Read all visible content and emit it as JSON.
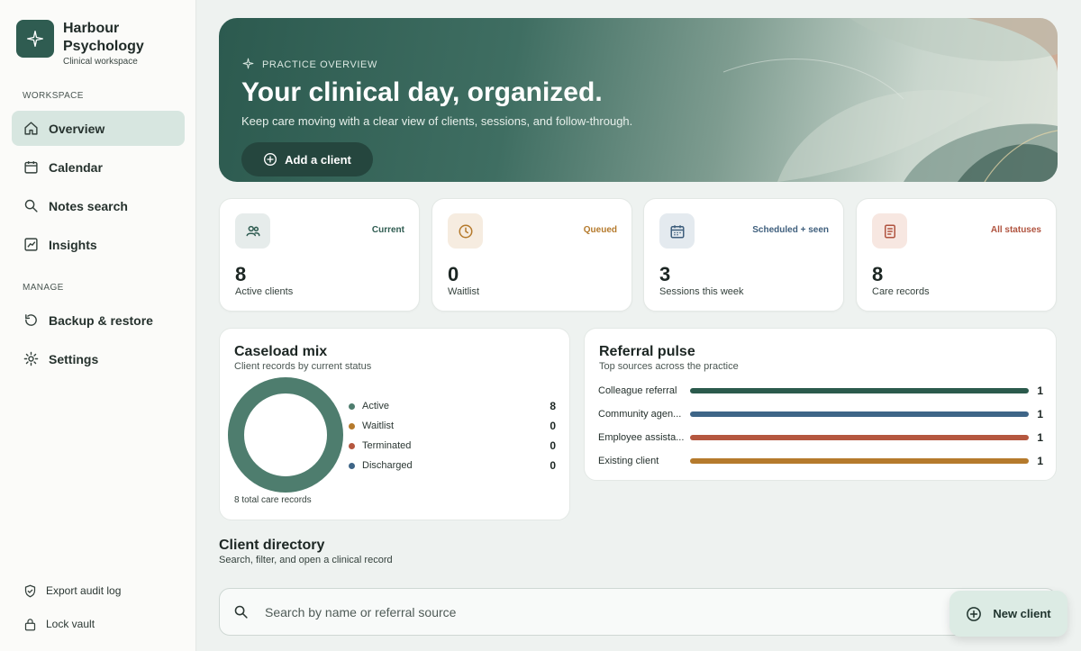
{
  "brand": {
    "name": "Harbour Psychology",
    "subtitle": "Clinical workspace"
  },
  "sidebar": {
    "workspace_label": "WORKSPACE",
    "manage_label": "MANAGE",
    "workspace_items": [
      {
        "label": "Overview",
        "icon": "home-icon",
        "active": true
      },
      {
        "label": "Calendar",
        "icon": "calendar-icon"
      },
      {
        "label": "Notes search",
        "icon": "search-icon"
      },
      {
        "label": "Insights",
        "icon": "chart-icon"
      }
    ],
    "manage_items": [
      {
        "label": "Backup & restore",
        "icon": "restore-icon"
      },
      {
        "label": "Settings",
        "icon": "gear-icon"
      }
    ],
    "footer_items": [
      {
        "label": "Export audit log",
        "icon": "shield-icon"
      },
      {
        "label": "Lock vault",
        "icon": "lock-icon"
      }
    ]
  },
  "hero": {
    "kicker": "PRACTICE OVERVIEW",
    "title": "Your clinical day, organized.",
    "description": "Keep care moving with a clear view of clients, sessions, and follow-through.",
    "button_label": "Add a client"
  },
  "stats": [
    {
      "tag": "Current",
      "value": "8",
      "label": "Active clients",
      "icon": "users-icon",
      "tag_color": "#2f5c51",
      "icon_bg": "#e6eceb"
    },
    {
      "tag": "Queued",
      "value": "0",
      "label": "Waitlist",
      "icon": "clock-icon",
      "tag_color": "#b57a2c",
      "icon_bg": "#f6ece0"
    },
    {
      "tag": "Scheduled + seen",
      "value": "3",
      "label": "Sessions this week",
      "icon": "calendar-icon",
      "tag_color": "#3f5f7d",
      "icon_bg": "#e4eaef"
    },
    {
      "tag": "All statuses",
      "value": "8",
      "label": "Care records",
      "icon": "document-icon",
      "tag_color": "#b0533f",
      "icon_bg": "#f7e7e1"
    }
  ],
  "caseload": {
    "title": "Caseload mix",
    "subtitle": "Client records by current status",
    "footer": "8 total care records",
    "items": [
      {
        "name": "Active",
        "value": 8,
        "color": "#4e7d6e"
      },
      {
        "name": "Waitlist",
        "value": 0,
        "color": "#b57a2c"
      },
      {
        "name": "Terminated",
        "value": 0,
        "color": "#b5573f"
      },
      {
        "name": "Discharged",
        "value": 0,
        "color": "#3e6587"
      }
    ]
  },
  "referral": {
    "title": "Referral pulse",
    "subtitle": "Top sources across the practice",
    "items": [
      {
        "name": "Colleague referral",
        "value": 1,
        "color": "#2b5a4c"
      },
      {
        "name": "Community agen...",
        "value": 1,
        "color": "#3e6587"
      },
      {
        "name": "Employee assista...",
        "value": 1,
        "color": "#b5573f"
      },
      {
        "name": "Existing client",
        "value": 1,
        "color": "#b57a2c"
      }
    ]
  },
  "directory": {
    "title": "Client directory",
    "subtitle": "Search, filter, and open a clinical record",
    "search_placeholder": "Search by name or referral source",
    "new_client_label": "New client"
  }
}
